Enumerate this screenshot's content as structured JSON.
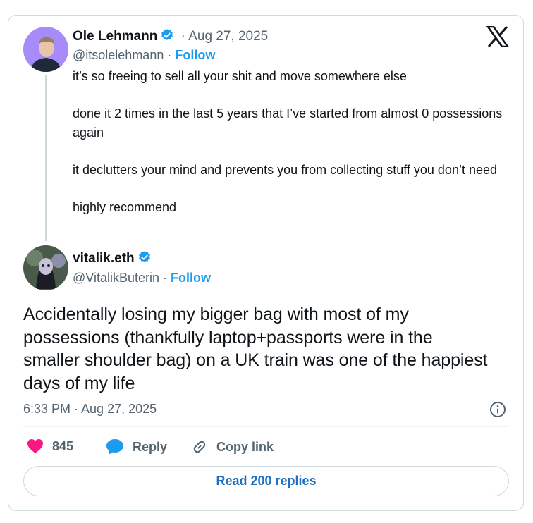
{
  "quoted_tweet": {
    "author_name": "Ole Lehmann",
    "date": "· Aug 27, 2025",
    "handle": "@itsolelehmann",
    "separator": "·",
    "follow_label": "Follow",
    "paragraphs": [
      "it’s so freeing to sell all your shit and move somewhere else",
      "done it 2 times in the last 5 years that I’ve started from almost 0 possessions again",
      "it declutters your mind and prevents you from collecting stuff you don’t need",
      "highly recommend"
    ]
  },
  "main_tweet": {
    "author_name": "vitalik.eth",
    "handle": "@VitalikButerin",
    "separator": "·",
    "follow_label": "Follow",
    "text": "Accidentally losing my bigger bag with most of my possessions (thankfully laptop+passports were in the smaller shoulder bag) on a UK train was one of the happiest days of my life",
    "timestamp": "6:33 PM · Aug 27, 2025"
  },
  "actions": {
    "like_count": "845",
    "reply_label": "Reply",
    "copy_link_label": "Copy link"
  },
  "read_replies_label": "Read 200 replies",
  "icons": {
    "brand": "x-logo-icon",
    "verified": "verified-badge-icon",
    "info": "info-icon",
    "like": "heart-icon",
    "reply": "speech-bubble-icon",
    "copy": "link-icon"
  },
  "colors": {
    "accent": "#1d9bf0",
    "like": "#f91880",
    "muted": "#536471",
    "border": "#cfd9de"
  }
}
